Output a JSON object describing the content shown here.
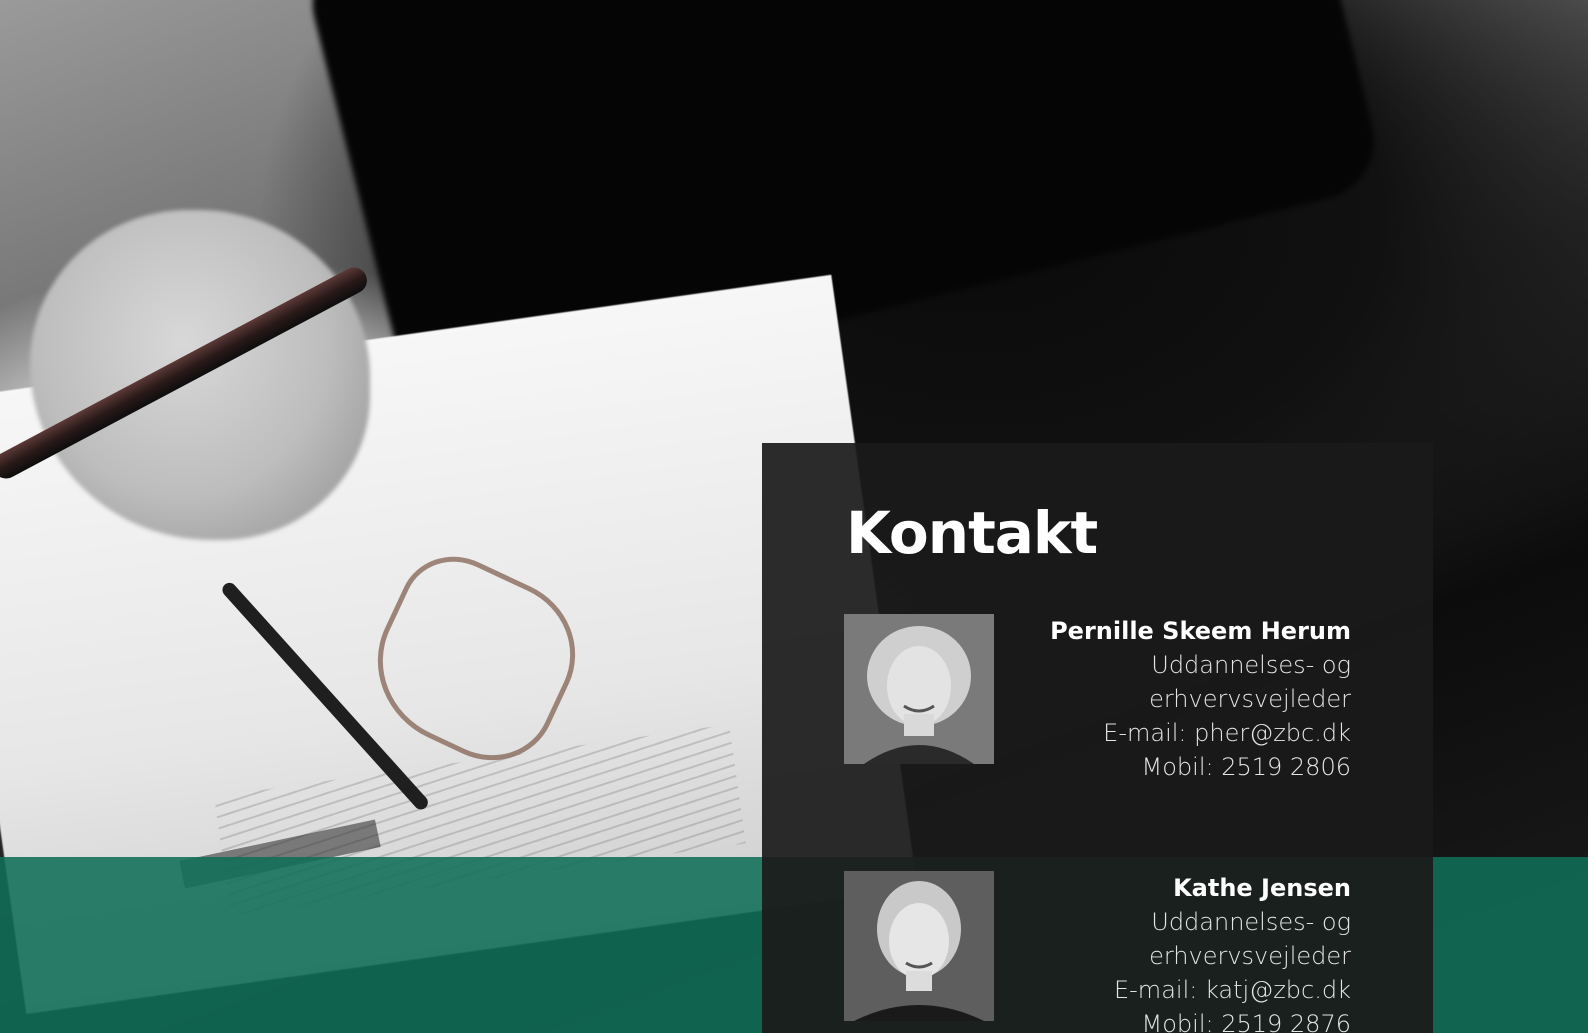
{
  "contact": {
    "title": "Kontakt",
    "people": [
      {
        "name": "Pernille Skeem Herum",
        "role_line1": "Uddannelses- og",
        "role_line2": "erhvervsvejleder",
        "email": "E-mail: pher@zbc.dk",
        "mobile": "Mobil: 2519 2806"
      },
      {
        "name": "Kathe Jensen",
        "role_line1": "Uddannelses- og",
        "role_line2": "erhvervsvejleder",
        "email": "E-mail: katj@zbc.dk",
        "mobile": "Mobil: 2519 2876"
      }
    ]
  },
  "colors": {
    "card_background": "#1a1a1a",
    "accent_green": "#106e58",
    "text": "#ffffff"
  }
}
